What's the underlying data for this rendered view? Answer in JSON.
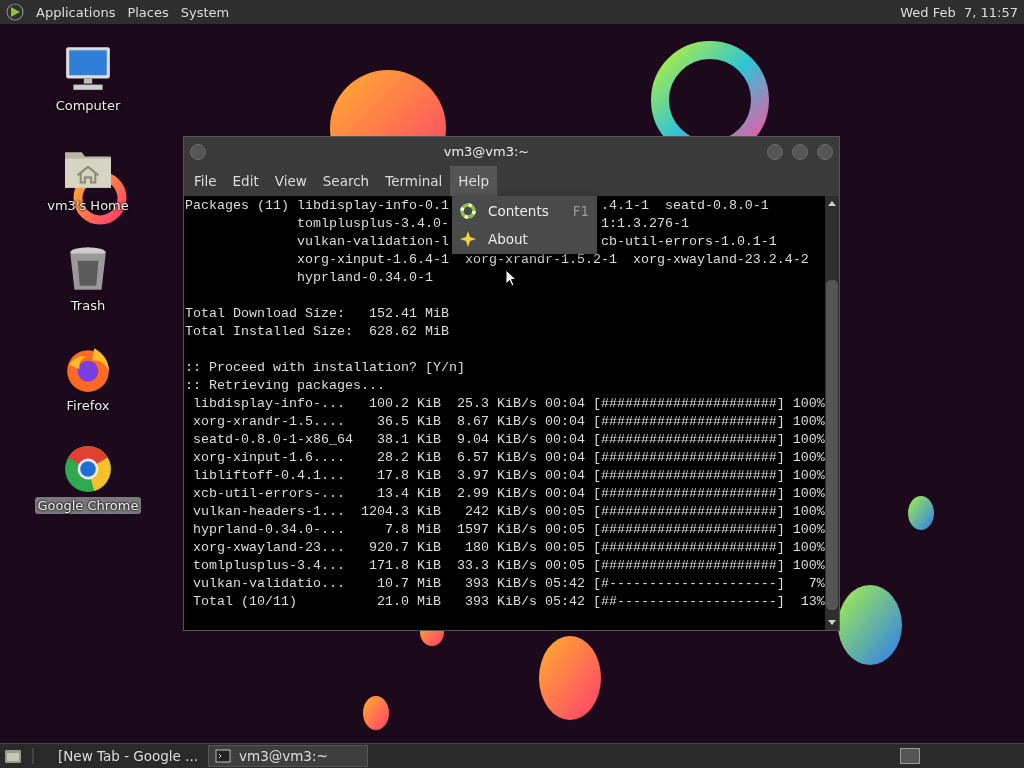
{
  "top_panel": {
    "menus": [
      "Applications",
      "Places",
      "System"
    ],
    "clock": "Wed Feb  7, 11:57"
  },
  "desktop_icons": [
    {
      "label": "Computer",
      "kind": "computer",
      "selected": false
    },
    {
      "label": "vm3's Home",
      "kind": "home",
      "selected": false
    },
    {
      "label": "Trash",
      "kind": "trash",
      "selected": false
    },
    {
      "label": "Firefox",
      "kind": "firefox",
      "selected": false
    },
    {
      "label": "Google Chrome",
      "kind": "chrome",
      "selected": true
    }
  ],
  "window": {
    "title": "vm3@vm3:~",
    "menus": [
      {
        "label": "File",
        "selected": false
      },
      {
        "label": "Edit",
        "selected": false
      },
      {
        "label": "View",
        "selected": false
      },
      {
        "label": "Search",
        "selected": false
      },
      {
        "label": "Terminal",
        "selected": false
      },
      {
        "label": "Help",
        "selected": true
      }
    ],
    "help_menu": [
      {
        "label": "Contents",
        "shortcut": "F1",
        "kind": "help"
      },
      {
        "label": "About",
        "kind": "about"
      }
    ],
    "terminal": {
      "blocks": [
        [
          {
            "text": "Packages (11) libdisplay-info-0.1",
            "after_menu": ".4.1-1  seatd-0.8.0-1"
          },
          {
            "text": "              tomlplusplus-3.4.0-",
            "after_menu": "1:1.3.276-1"
          },
          {
            "text": "              vulkan-validation-l",
            "after_menu": "cb-util-errors-1.0.1-1"
          },
          {
            "text": "              xorg-xinput-1.6.4-1  xorg-xrandr-1.5.2-1  xorg-xwayland-23.2.4-2"
          },
          {
            "text": "              hyprland-0.34.0-1"
          }
        ],
        [
          {
            "text": "Total Download Size:   152.41 MiB"
          },
          {
            "text": "Total Installed Size:  628.62 MiB"
          }
        ],
        [
          {
            "text": ":: Proceed with installation? [Y/n]"
          },
          {
            "text": ":: Retrieving packages..."
          },
          {
            "text": " libdisplay-info-...   100.2 KiB  25.3 KiB/s 00:04 [######################] 100%"
          },
          {
            "text": " xorg-xrandr-1.5....    36.5 KiB  8.67 KiB/s 00:04 [######################] 100%"
          },
          {
            "text": " seatd-0.8.0-1-x86_64   38.1 KiB  9.04 KiB/s 00:04 [######################] 100%"
          },
          {
            "text": " xorg-xinput-1.6....    28.2 KiB  6.57 KiB/s 00:04 [######################] 100%"
          },
          {
            "text": " libliftoff-0.4.1...    17.8 KiB  3.97 KiB/s 00:04 [######################] 100%"
          },
          {
            "text": " xcb-util-errors-...    13.4 KiB  2.99 KiB/s 00:04 [######################] 100%"
          },
          {
            "text": " vulkan-headers-1...  1204.3 KiB   242 KiB/s 00:05 [######################] 100%"
          },
          {
            "text": " hyprland-0.34.0-...     7.8 MiB  1597 KiB/s 00:05 [######################] 100%"
          },
          {
            "text": " xorg-xwayland-23...   920.7 KiB   180 KiB/s 00:05 [######################] 100%"
          },
          {
            "text": " tomlplusplus-3.4...   171.8 KiB  33.3 KiB/s 00:05 [######################] 100%"
          },
          {
            "text": " vulkan-validatio...    10.7 MiB   393 KiB/s 05:42 [#---------------------]   7%"
          },
          {
            "text": " Total (10/11)          21.0 MiB   393 KiB/s 05:42 [##--------------------]  13%"
          }
        ]
      ]
    }
  },
  "taskbar": {
    "tasks": [
      {
        "label": "[New Tab - Google ...",
        "kind": "browser",
        "selected": false
      },
      {
        "label": "vm3@vm3:~",
        "kind": "terminal",
        "selected": true
      }
    ]
  }
}
